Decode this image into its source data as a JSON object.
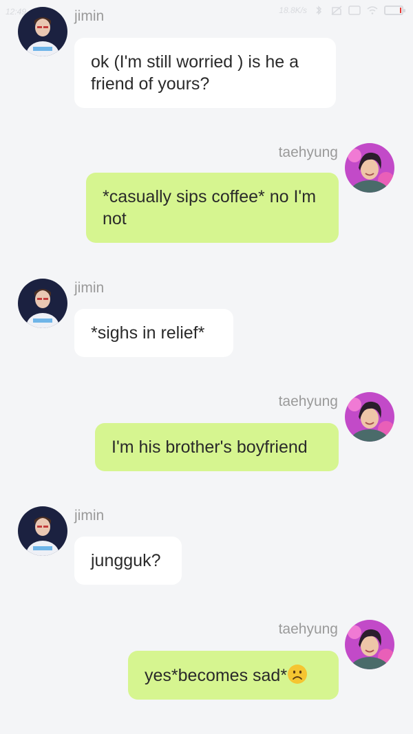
{
  "status_bar": {
    "time": "12:49",
    "network_speed": "18.8K/s"
  },
  "messages": [
    {
      "sender": "jimin",
      "side": "left",
      "text": "ok (I'm still worried ) is he a friend of yours?"
    },
    {
      "sender": "taehyung",
      "side": "right",
      "text": "*casually sips coffee* no I'm not"
    },
    {
      "sender": "jimin",
      "side": "left",
      "text": "*sighs in relief*"
    },
    {
      "sender": "taehyung",
      "side": "right",
      "text": "I'm his brother's boyfriend"
    },
    {
      "sender": "jimin",
      "side": "left",
      "text": "jungguk?"
    },
    {
      "sender": "taehyung",
      "side": "right",
      "text": "yes*becomes sad*"
    }
  ],
  "emoji": {
    "message_6": "worried-face-emoji"
  },
  "colors": {
    "background": "#f4f5f7",
    "incoming_bubble": "#ffffff",
    "outgoing_bubble": "#d6f590",
    "sender_name": "#9a9a9a",
    "message_text": "#2a2a2a"
  }
}
